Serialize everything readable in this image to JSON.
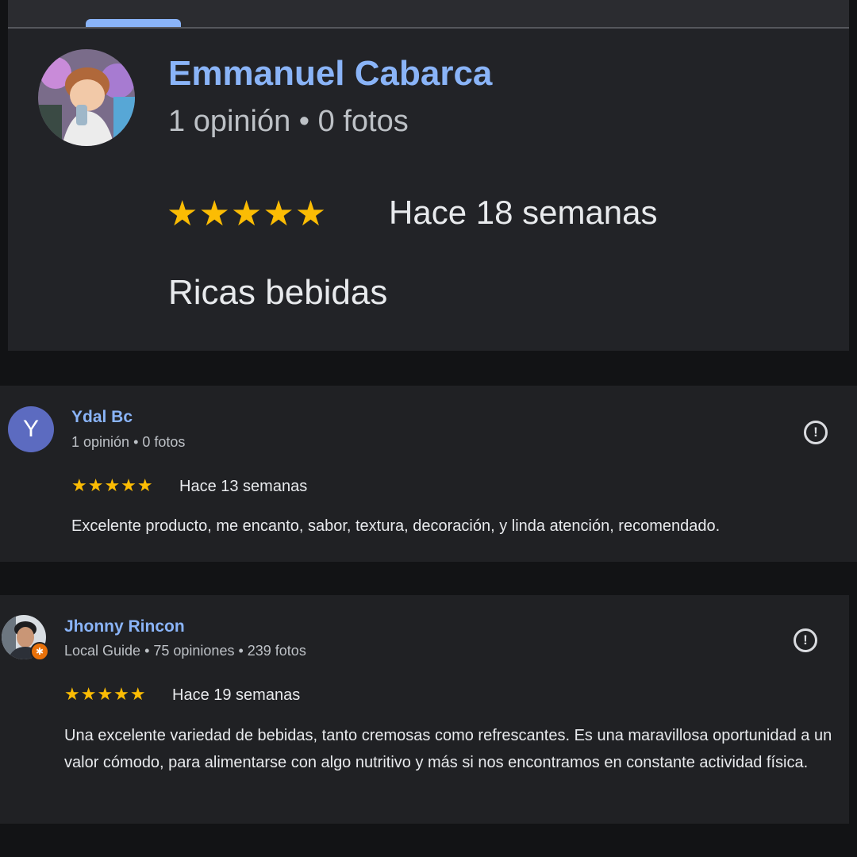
{
  "colors": {
    "background": "#121315",
    "card": "#202124",
    "name": "#8ab4f8",
    "star": "#fbbc04",
    "text": "#e8eaed",
    "meta": "#bdc1c6",
    "local_guide_badge": "#e8710a",
    "avatar_y": "#5c6bc0"
  },
  "reviews": [
    {
      "author": "Emmanuel Cabarca",
      "meta": "1 opinión • 0 fotos",
      "stars": "★★★★★",
      "rating": 5,
      "when": "Hace 18 semanas",
      "text": "Ricas bebidas",
      "avatar": "anime-character-avatar"
    },
    {
      "author": "Ydal Bc",
      "meta": "1 opinión • 0 fotos",
      "stars": "★★★★★",
      "rating": 5,
      "when": "Hace 13 semanas",
      "text": "Excelente producto, me encanto, sabor, textura, decoración, y linda atención, recomendado.",
      "avatar_letter": "Y",
      "report_icon": "!"
    },
    {
      "author": "Jhonny Rincon",
      "meta": "Local Guide • 75 opiniones • 239 fotos",
      "stars": "★★★★★",
      "rating": 5,
      "when": "Hace 19 semanas",
      "text": "Una excelente variedad de bebidas, tanto cremosas como refrescantes. Es una maravillosa oportunidad a un valor cómodo, para alimentarse con algo nutritivo y más si nos encontramos en constante actividad física.",
      "avatar": "profile-photo-avatar",
      "badge": "✱",
      "report_icon": "!"
    }
  ]
}
